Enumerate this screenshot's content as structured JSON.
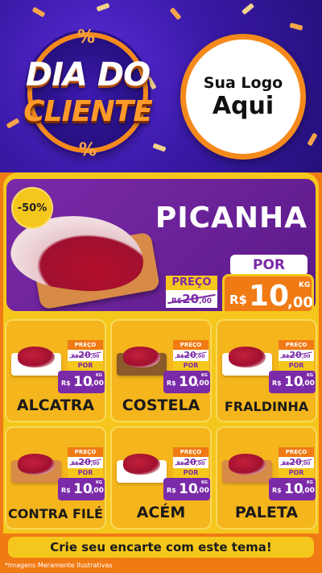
{
  "header": {
    "badge_line1": "DIA DO",
    "badge_line2": "CLIENTE",
    "percent_symbol": "%",
    "logo_line1": "Sua Logo",
    "logo_line2": "Aqui"
  },
  "featured": {
    "discount": "-50%",
    "name": "PICANHA",
    "por_label": "POR",
    "preco_label": "PREÇO",
    "currency": "R$",
    "old_price_int": "20",
    "old_price_dec": ",00",
    "new_price_int": "10",
    "new_price_dec": ",00",
    "unit": "KG"
  },
  "products": [
    {
      "name": "ALCATRA",
      "preco_label": "PREÇO",
      "por_label": "POR",
      "currency": "R$",
      "old_int": "20",
      "old_dec": ",00",
      "new_int": "10",
      "new_dec": ",00",
      "unit": "KG"
    },
    {
      "name": "COSTELA",
      "preco_label": "PREÇO",
      "por_label": "POR",
      "currency": "R$",
      "old_int": "20",
      "old_dec": ",00",
      "new_int": "10",
      "new_dec": ",00",
      "unit": "KG"
    },
    {
      "name": "FRALDINHA",
      "preco_label": "PREÇO",
      "por_label": "POR",
      "currency": "R$",
      "old_int": "20",
      "old_dec": ",00",
      "new_int": "10",
      "new_dec": ",00",
      "unit": "KG"
    },
    {
      "name": "CONTRA FILÉ",
      "preco_label": "PREÇO",
      "por_label": "POR",
      "currency": "R$",
      "old_int": "20",
      "old_dec": ",00",
      "new_int": "10",
      "new_dec": ",00",
      "unit": "KG"
    },
    {
      "name": "ACÉM",
      "preco_label": "PREÇO",
      "por_label": "POR",
      "currency": "R$",
      "old_int": "20",
      "old_dec": ",00",
      "new_int": "10",
      "new_dec": ",00",
      "unit": "KG"
    },
    {
      "name": "PALETA",
      "preco_label": "PREÇO",
      "por_label": "POR",
      "currency": "R$",
      "old_int": "20",
      "old_dec": ",00",
      "new_int": "10",
      "new_dec": ",00",
      "unit": "KG"
    }
  ],
  "footer": {
    "cta": "Crie seu encarte com este tema!",
    "disclaimer": "*Imagens Meramente Ilustrativas"
  },
  "colors": {
    "purple": "#7b2aa8",
    "orange": "#f07a14",
    "yellow": "#f5c71c"
  }
}
